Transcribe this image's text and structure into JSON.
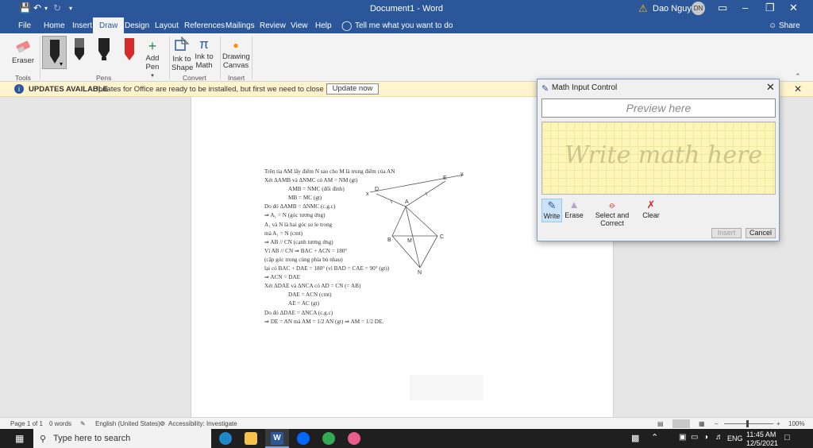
{
  "window": {
    "title": "Document1 - Word",
    "user_name": "Dao Nguyen",
    "user_initials": "DN"
  },
  "tabs": [
    "File",
    "Home",
    "Insert",
    "Draw",
    "Design",
    "Layout",
    "References",
    "Mailings",
    "Review",
    "View",
    "Help"
  ],
  "active_tab": "Draw",
  "tell_me": "Tell me what you want to do",
  "share": "Share",
  "ribbon": {
    "eraser": "Eraser",
    "add_pen": "Add Pen",
    "ink_to_shape": "Ink to Shape",
    "ink_to_math": "Ink to Math",
    "drawing_canvas": "Drawing Canvas",
    "groups": {
      "tools": "Tools",
      "pens": "Pens",
      "convert": "Convert",
      "insert": "Insert"
    }
  },
  "infobar": {
    "heading": "UPDATES AVAILABLE",
    "message": "Updates for Office are ready to be installed, but first we need to close some apps.",
    "button": "Update now"
  },
  "document_text": [
    "Trên tia AM lấy điểm N sao cho M là trung điểm của AN",
    "Xét ΔAMB và ΔNMC có AM = NM (gt)",
    "AMB = NMC (đối đỉnh)",
    "MB = MC (gt)",
    "Do đó ΔAMB = ΔNMC (c.g.c)",
    "⇒ A₁ = N (góc tương ứng)",
    "A₁ và N là hai góc so le trong",
    "mà A₁ = N (cmt)",
    "⇒ AB // CN (cạnh tương ứng)",
    "Vì AB // CN ⇒ BAC + ACN = 180°",
    "(cặp góc trong cùng phía bù nhau)",
    "lại có BAC + DAE = 180° (vì BAD = CAE = 90° (gt))",
    "⇒ ACN = DAE",
    "Xét ΔDAE và ΔNCA có AD = CN (= AB)",
    "DAE = ACN (cmt)",
    "AE = AC (gt)",
    "Do đó ΔDAE = ΔNCA (c.g.c)",
    "⇒ DE = AN mà AM = 1/2 AN (gt) ⇒ AM = 1/2 DE."
  ],
  "figure_labels": {
    "y": "y",
    "E": "E",
    "D": "D",
    "x": "x",
    "A": "A",
    "B": "B",
    "M": "M",
    "C": "C",
    "N": "N"
  },
  "status": {
    "page": "Page 1 of 1",
    "words": "0 words",
    "language": "English (United States)",
    "accessibility": "Accessibility: Investigate",
    "zoom": "100%"
  },
  "taskbar": {
    "search_placeholder": "Type here to search",
    "time": "11:45 AM",
    "date": "12/5/2021",
    "lang": "ENG"
  },
  "dialog": {
    "title": "Math Input Control",
    "preview": "Preview here",
    "write_hint": "Write math here",
    "tools": [
      "Write",
      "Erase",
      "Select and Correct",
      "Clear"
    ],
    "insert": "Insert",
    "cancel": "Cancel"
  },
  "colors": {
    "word_blue": "#2b579a",
    "infobar": "#fff4ce",
    "writepad": "#fdf6b8"
  }
}
